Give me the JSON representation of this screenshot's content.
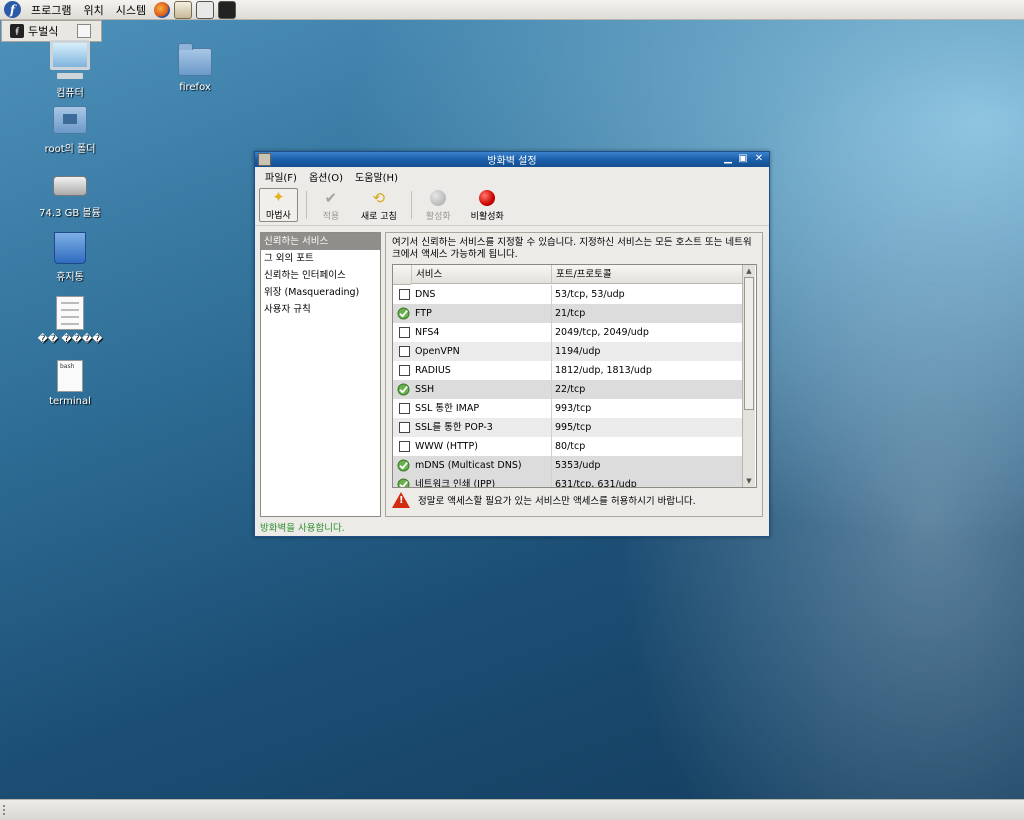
{
  "top_panel": {
    "menus": [
      "프로그램",
      "위치",
      "시스템"
    ],
    "launchers": [
      "firefox-icon",
      "mail-icon",
      "text-editor-icon",
      "terminal-icon"
    ]
  },
  "taskbar": {
    "item_label": "두벌식"
  },
  "desktop_icons": [
    {
      "label": "컴퓨터",
      "icon": "computer-icon"
    },
    {
      "label": "firefox",
      "icon": "folder-icon"
    },
    {
      "label": "root의 폴더",
      "icon": "home-folder-icon"
    },
    {
      "label": "74.3 GB 볼륨",
      "icon": "drive-icon"
    },
    {
      "label": "휴지통",
      "icon": "trash-icon"
    },
    {
      "label": "�� ����",
      "icon": "document-icon"
    },
    {
      "label": "terminal",
      "icon": "script-icon",
      "badge": "bash"
    }
  ],
  "window": {
    "title": "방화벽 설정",
    "menu": [
      "파일(F)",
      "옵션(O)",
      "도움말(H)"
    ],
    "toolbar": {
      "wizard": "마법사",
      "apply": "적용",
      "reload": "새로 고침",
      "enable": "활성화",
      "disable": "비활성화"
    },
    "sidebar": [
      "신뢰하는 서비스",
      "그 외의 포트",
      "신뢰하는 인터페이스",
      "위장 (Masquerading)",
      "사용자 규칙"
    ],
    "description": "여기서 신뢰하는 서비스를 지정할 수 있습니다. 지정하신 서비스는 모든 호스트 또는 네트워크에서 액세스 가능하게 됩니다.",
    "table": {
      "headers": [
        "서비스",
        "포트/프로토콜"
      ],
      "rows": [
        {
          "service": "DNS",
          "port": "53/tcp, 53/udp",
          "checked": false
        },
        {
          "service": "FTP",
          "port": "21/tcp",
          "checked": true
        },
        {
          "service": "NFS4",
          "port": "2049/tcp, 2049/udp",
          "checked": false
        },
        {
          "service": "OpenVPN",
          "port": "1194/udp",
          "checked": false
        },
        {
          "service": "RADIUS",
          "port": "1812/udp, 1813/udp",
          "checked": false
        },
        {
          "service": "SSH",
          "port": "22/tcp",
          "checked": true
        },
        {
          "service": "SSL 통한 IMAP",
          "port": "993/tcp",
          "checked": false
        },
        {
          "service": "SSL를 통한 POP-3",
          "port": "995/tcp",
          "checked": false
        },
        {
          "service": "WWW (HTTP)",
          "port": "80/tcp",
          "checked": false
        },
        {
          "service": "mDNS (Multicast DNS)",
          "port": "5353/udp",
          "checked": true
        },
        {
          "service": "네트워크 인쇄 (IPP)",
          "port": "631/tcp, 631/udp",
          "checked": true
        }
      ]
    },
    "warning": "정말로 액세스할 필요가 있는 서비스만 액세스를 허용하시기 바랍니다.",
    "status": "방화벽을 사용합니다."
  },
  "colors": {
    "titlebar": "#1b5fa9",
    "status_text": "#2e8f2e",
    "warning": "#d32b0f",
    "disable_button": "#cc0000"
  }
}
